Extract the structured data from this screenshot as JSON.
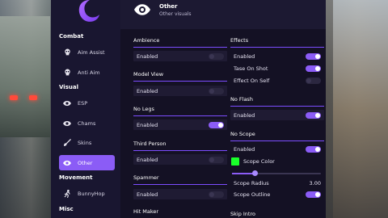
{
  "sidebar": {
    "sections": [
      {
        "title": "Combat",
        "items": [
          {
            "label": "Aim Assist",
            "icon": "skull-icon"
          },
          {
            "label": "Anti Aim",
            "icon": "skull-icon"
          }
        ]
      },
      {
        "title": "Visual",
        "items": [
          {
            "label": "ESP",
            "icon": "eye-icon"
          },
          {
            "label": "Chams",
            "icon": "eye-icon"
          },
          {
            "label": "Skins",
            "icon": "brush-icon"
          },
          {
            "label": "Other",
            "icon": "eye-icon",
            "active": true
          }
        ]
      },
      {
        "title": "Movement",
        "items": [
          {
            "label": "BunnyHop",
            "icon": "runner-icon"
          }
        ]
      },
      {
        "title": "Misc",
        "items": []
      }
    ]
  },
  "header": {
    "title": "Other",
    "subtitle": "Other visuals",
    "icon": "eye-icon"
  },
  "left_column": {
    "ambience": {
      "title": "Ambience",
      "enabled_label": "Enabled",
      "enabled": false
    },
    "model_view": {
      "title": "Model View",
      "enabled_label": "Enabled",
      "enabled": false
    },
    "no_legs": {
      "title": "No Legs",
      "enabled_label": "Enabled",
      "enabled": true
    },
    "third_person": {
      "title": "Third Person",
      "enabled_label": "Enabled",
      "enabled": false
    },
    "spammer": {
      "title": "Spammer",
      "enabled_label": "Enabled",
      "enabled": false
    },
    "hit_maker": {
      "title": "Hit Maker"
    }
  },
  "right_column": {
    "effects": {
      "title": "Effects",
      "rows": [
        {
          "label": "Enabled",
          "enabled": true
        },
        {
          "label": "Tase On Shot",
          "enabled": true
        },
        {
          "label": "Effect On Self",
          "enabled": false
        }
      ]
    },
    "no_flash": {
      "title": "No Flash",
      "enabled_label": "Enabled",
      "enabled": true
    },
    "no_scope": {
      "title": "No Scope",
      "enabled_label": "Enabled",
      "enabled": true,
      "scope_color_label": "Scope Color",
      "scope_color": "#19ff2a",
      "scope_radius_label": "Scope Radius",
      "scope_radius_value": "3.00",
      "scope_radius_fraction": 0.25,
      "scope_outline_label": "Scope Outline",
      "scope_outline": true
    },
    "skip_intro": {
      "title": "Skip Intro"
    }
  },
  "colors": {
    "accent": "#8b5cf6",
    "panel": "#171427",
    "row": "#1f1b33"
  }
}
